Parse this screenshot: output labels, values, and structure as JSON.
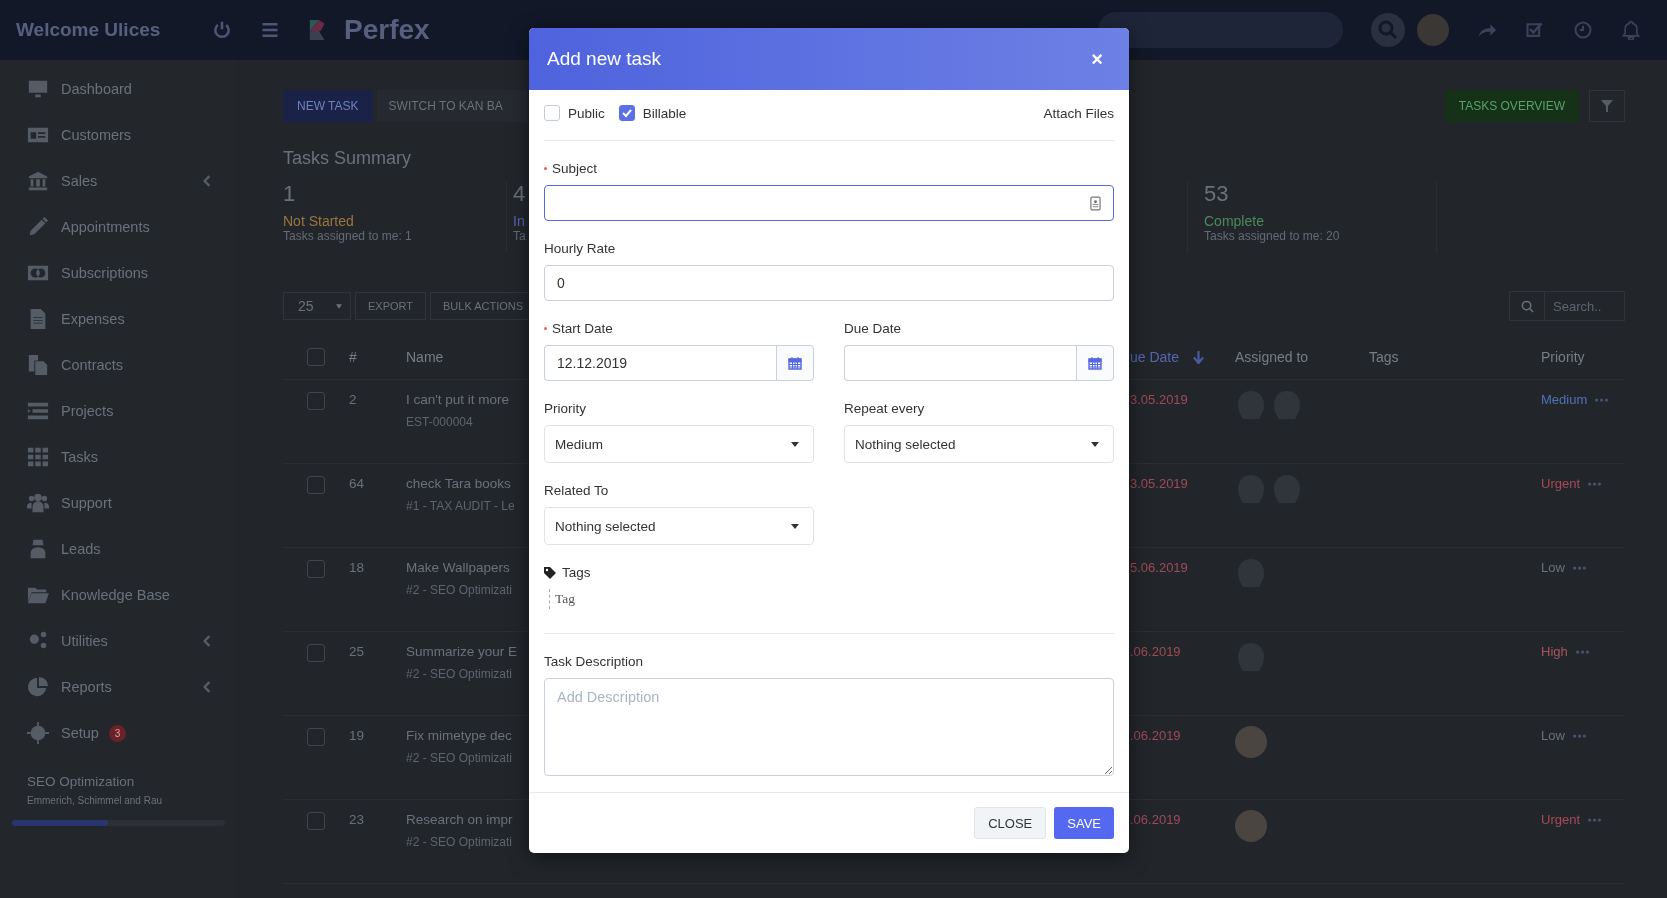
{
  "top_bar": {
    "welcome": "Welcome Ulices",
    "brand": "Perfex"
  },
  "sidebar": {
    "items": [
      {
        "label": "Dashboard",
        "expandable": false
      },
      {
        "label": "Customers",
        "expandable": false
      },
      {
        "label": "Sales",
        "expandable": true
      },
      {
        "label": "Appointments",
        "expandable": false
      },
      {
        "label": "Subscriptions",
        "expandable": false
      },
      {
        "label": "Expenses",
        "expandable": false
      },
      {
        "label": "Contracts",
        "expandable": false
      },
      {
        "label": "Projects",
        "expandable": false
      },
      {
        "label": "Tasks",
        "expandable": false
      },
      {
        "label": "Support",
        "expandable": false
      },
      {
        "label": "Leads",
        "expandable": false
      },
      {
        "label": "Knowledge Base",
        "expandable": false
      },
      {
        "label": "Utilities",
        "expandable": true
      },
      {
        "label": "Reports",
        "expandable": true
      },
      {
        "label": "Setup",
        "expandable": false,
        "badge": "3"
      }
    ],
    "project": {
      "name": "SEO Optimization",
      "client": "Emmerich, Schimmel and Rau",
      "level": 0.45
    }
  },
  "toolbar": {
    "new_task": "NEW TASK",
    "switch_view": "SWITCH TO KAN BA",
    "overview": "TASKS OVERVIEW"
  },
  "summary": {
    "title": "Tasks Summary",
    "stats": [
      {
        "count": "1",
        "status": "Not Started",
        "detail": "Tasks assigned to me: 1",
        "color": "#9a7540"
      },
      {
        "count": "4",
        "status": "In",
        "detail": "Ta",
        "color": "#5566b8"
      },
      {
        "count": "53",
        "status": "Complete",
        "detail": "Tasks assigned to me: 20",
        "color": "#4c8a5a"
      }
    ]
  },
  "table_controls": {
    "page_size": "25",
    "export": "EXPORT",
    "bulk_actions": "BULK ACTIONS",
    "search_placeholder": "Search.."
  },
  "table": {
    "columns": [
      "#",
      "Name",
      "ue Date",
      "Assigned to",
      "Tags",
      "Priority"
    ],
    "select_all_checked": false,
    "rows": [
      {
        "checked": false,
        "number": "2",
        "name": "I can't put it more",
        "subtitle": "EST-000004",
        "due": "3.05.2019",
        "assignees": [
          {
            "kind": "silhouette"
          },
          {
            "kind": "silhouette"
          }
        ],
        "priority": {
          "label": "Medium",
          "color": "#4f72b8"
        }
      },
      {
        "checked": false,
        "number": "64",
        "name": "check Tara books",
        "subtitle": "#1 - TAX AUDIT - Le",
        "due": "3.05.2019",
        "assignees": [
          {
            "kind": "silhouette"
          },
          {
            "kind": "silhouette"
          }
        ],
        "priority": {
          "label": "Urgent",
          "color": "#a64a58"
        }
      },
      {
        "checked": false,
        "number": "18",
        "name": "Make Wallpapers",
        "subtitle": "#2 - SEO Optimizati",
        "due": "5.06.2019",
        "assignees": [
          {
            "kind": "silhouette"
          }
        ],
        "priority": {
          "label": "Low",
          "color": "#6a717b"
        }
      },
      {
        "checked": false,
        "number": "25",
        "name": "Summarize your E",
        "subtitle": "#2 - SEO Optimizati",
        "due": ".06.2019",
        "assignees": [
          {
            "kind": "silhouette"
          }
        ],
        "priority": {
          "label": "High",
          "color": "#a65560"
        }
      },
      {
        "checked": false,
        "number": "19",
        "name": "Fix mimetype dec",
        "subtitle": "#2 - SEO Optimizati",
        "due": ".06.2019",
        "assignees": [
          {
            "kind": "photo"
          }
        ],
        "priority": {
          "label": "Low",
          "color": "#6a717b"
        }
      },
      {
        "checked": false,
        "number": "23",
        "name": "Research on impr",
        "subtitle": "#2 - SEO Optimizati",
        "due": ".06.2019",
        "assignees": [
          {
            "kind": "photo"
          }
        ],
        "priority": {
          "label": "Urgent",
          "color": "#a64a58"
        }
      }
    ]
  },
  "modal": {
    "title": "Add new task",
    "close": "×",
    "options": [
      {
        "label": "Public",
        "checked": false
      },
      {
        "label": "Billable",
        "checked": true
      }
    ],
    "attach": "Attach Files",
    "subject": {
      "label": "Subject",
      "required": true,
      "focused": true
    },
    "hourly_rate": {
      "label": "Hourly Rate",
      "value": "0"
    },
    "start_date": {
      "label": "Start Date",
      "required": true,
      "value": "12.12.2019"
    },
    "due_date": {
      "label": "Due Date",
      "required": false
    },
    "priority": {
      "label": "Priority",
      "value": "Medium"
    },
    "repeat": {
      "label": "Repeat every",
      "value": "Nothing selected"
    },
    "related_to": {
      "label": "Related To",
      "value": "Nothing selected"
    },
    "tags": {
      "label": "Tags",
      "placeholder": "Tag"
    },
    "description": {
      "label": "Task Description",
      "placeholder": "Add Description"
    },
    "buttons": [
      {
        "label": "CLOSE",
        "kind": "secondary"
      },
      {
        "label": "SAVE",
        "kind": "primary"
      }
    ]
  }
}
